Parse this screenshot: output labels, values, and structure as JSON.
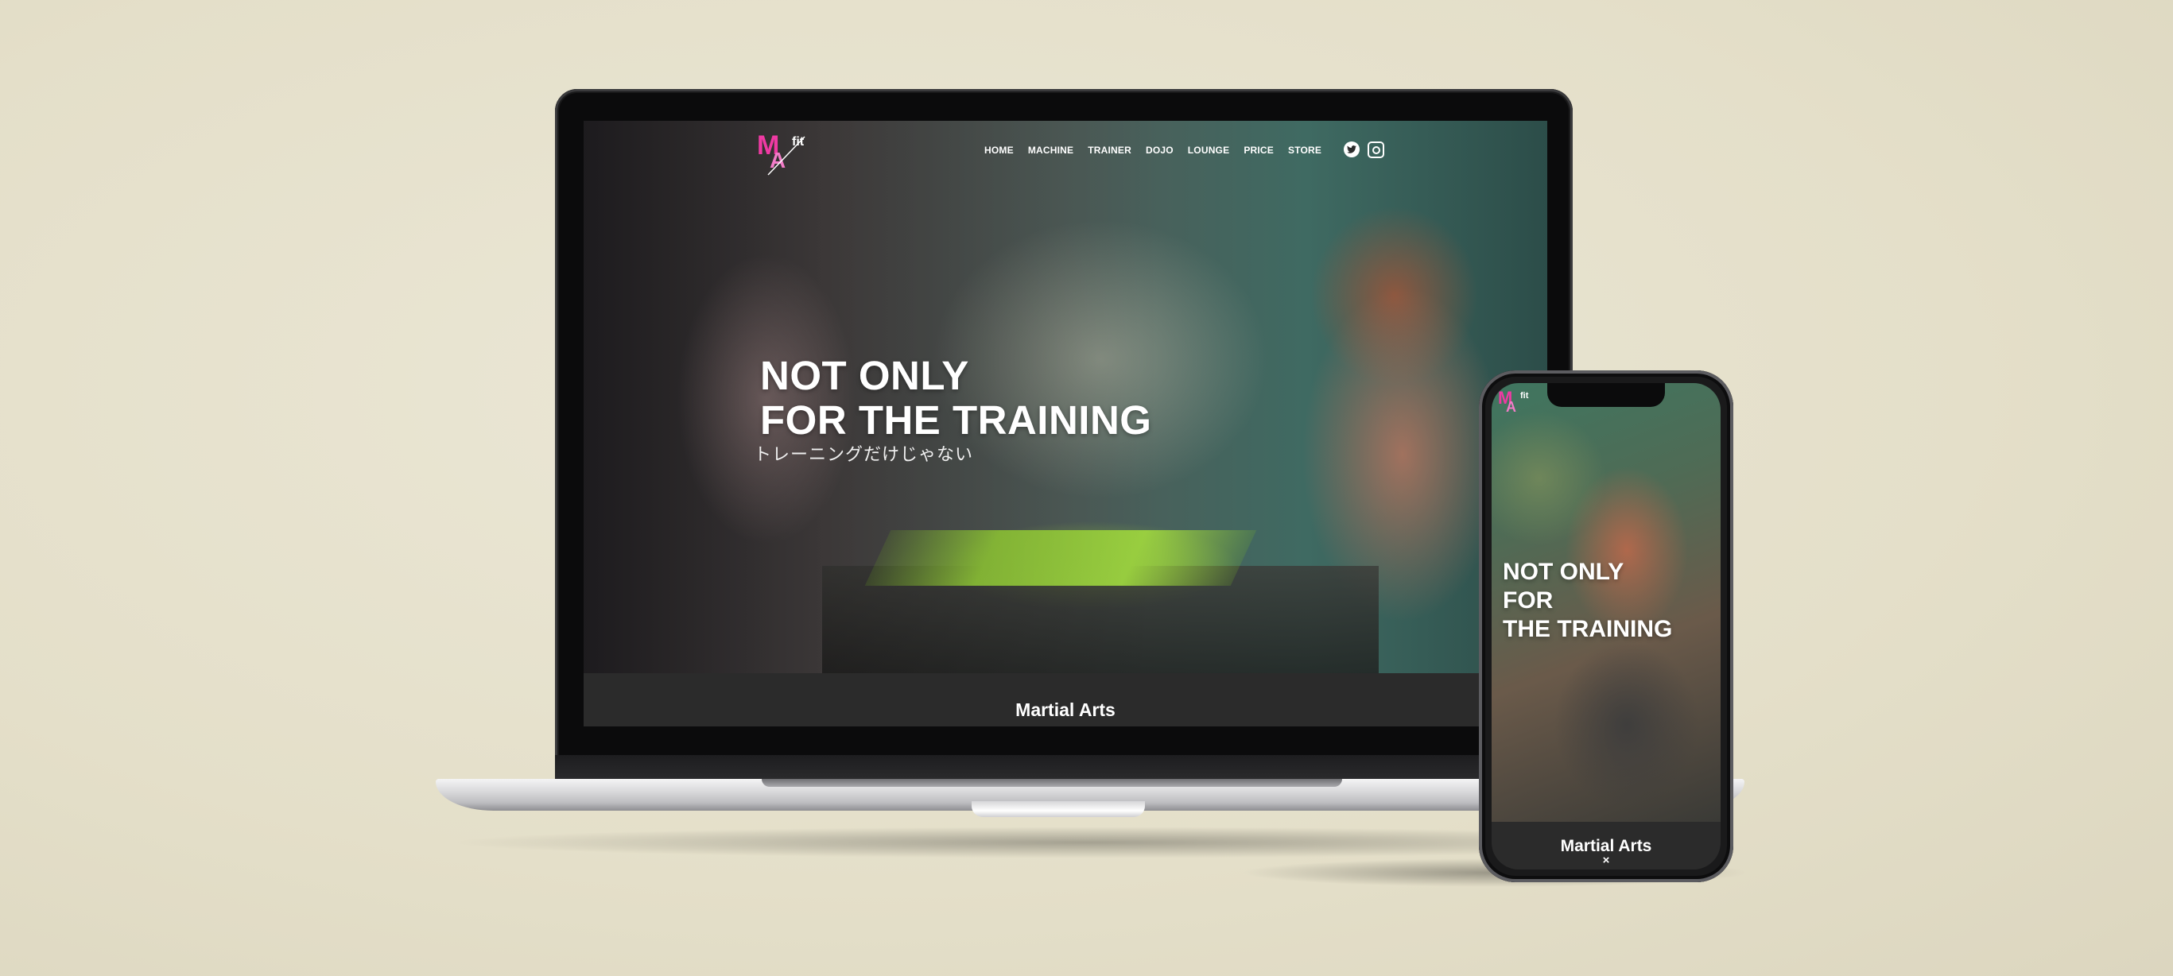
{
  "laptop": {
    "logo": {
      "m": "M",
      "a": "A",
      "fit": "fit"
    },
    "nav": [
      "HOME",
      "MACHINE",
      "TRAINER",
      "DOJO",
      "LOUNGE",
      "PRICE",
      "STORE"
    ],
    "hero": {
      "title_line1": "NOT ONLY",
      "title_line2": "FOR THE TRAINING",
      "subtitle": "トレーニングだけじゃない"
    },
    "section": {
      "label": "Martial Arts",
      "chevron": "⌄"
    }
  },
  "phone": {
    "logo": {
      "m": "M",
      "a": "A",
      "fit": "fit"
    },
    "hero": {
      "title_line1": "NOT ONLY",
      "title_line2": "FOR",
      "title_line3": "THE TRAINING"
    },
    "section": {
      "label": "Martial Arts",
      "close": "×"
    }
  },
  "colors": {
    "background": "#e4dfc9",
    "logo_magenta": "#ef3aa3",
    "logo_pink": "#f27cc8",
    "section_bar": "#2b2b2b"
  },
  "icons": [
    "twitter-icon",
    "instagram-icon",
    "chevron-down-icon",
    "close-icon"
  ]
}
